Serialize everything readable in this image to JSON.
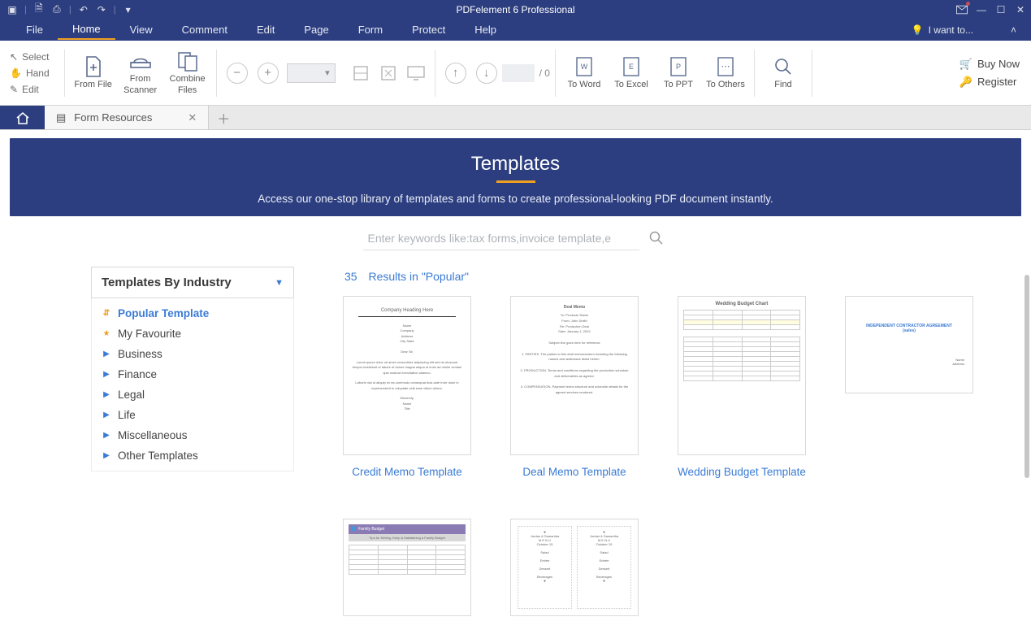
{
  "app": {
    "title": "PDFelement 6 Professional"
  },
  "menubar": {
    "items": [
      "File",
      "Home",
      "View",
      "Comment",
      "Edit",
      "Page",
      "Form",
      "Protect",
      "Help"
    ],
    "active": 1,
    "iwant": "I want to..."
  },
  "ribbon": {
    "left": {
      "select": "Select",
      "hand": "Hand",
      "edit": "Edit"
    },
    "fromFile": "From File",
    "fromScanner": "From Scanner",
    "combineFiles": "Combine Files",
    "toWord": "To Word",
    "toExcel": "To Excel",
    "toPPT": "To PPT",
    "toOthers": "To Others",
    "find": "Find",
    "pageTotal": "/  0",
    "buyNow": "Buy Now",
    "register": "Register"
  },
  "tabs": {
    "formResources": "Form Resources"
  },
  "templates": {
    "heading": "Templates",
    "sub": "Access our one-stop library of templates and forms to create professional-looking PDF document instantly.",
    "searchPlaceholder": "Enter keywords like:tax forms,invoice template,e"
  },
  "sidebar": {
    "header": "Templates By Industry",
    "items": [
      {
        "label": "Popular Template",
        "kind": "popular"
      },
      {
        "label": "My Favourite",
        "kind": "fav"
      },
      {
        "label": "Business",
        "kind": "cat"
      },
      {
        "label": "Finance",
        "kind": "cat"
      },
      {
        "label": "Legal",
        "kind": "cat"
      },
      {
        "label": "Life",
        "kind": "cat"
      },
      {
        "label": "Miscellaneous",
        "kind": "cat"
      },
      {
        "label": "Other Templates",
        "kind": "cat"
      }
    ]
  },
  "results": {
    "count": "35",
    "label": "Results in \"Popular\"",
    "cards": [
      {
        "title": "Credit Memo Template"
      },
      {
        "title": "Deal Memo Template"
      },
      {
        "title": "Wedding Budget Template"
      },
      {
        "title": ""
      },
      {
        "title": ""
      },
      {
        "title": ""
      }
    ]
  }
}
